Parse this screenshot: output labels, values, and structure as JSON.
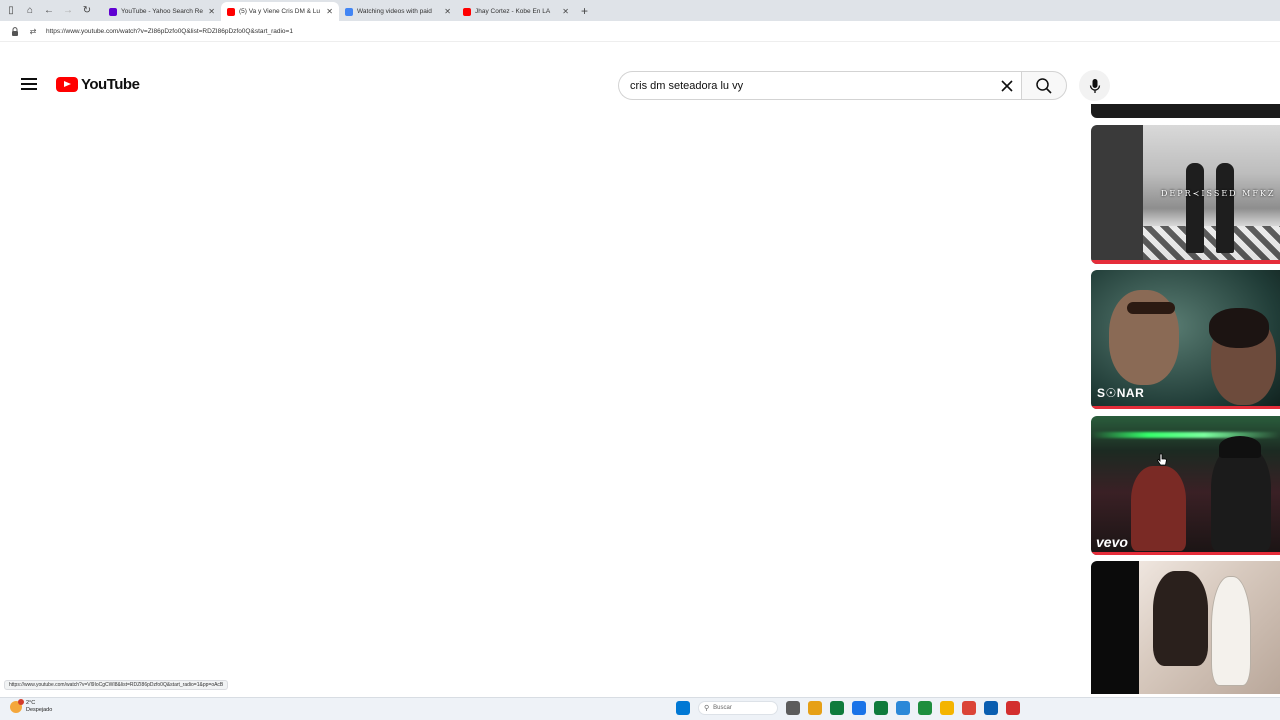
{
  "browser": {
    "tabs": [
      {
        "title": "YouTube - Yahoo Search Re",
        "favicon_color": "#6001d2",
        "active": false
      },
      {
        "title": "(5) Va y Viene Cris DM & Lu",
        "favicon_color": "#ff0000",
        "active": true
      },
      {
        "title": "Watching videos with paid",
        "favicon_color": "#4285f4",
        "active": false
      },
      {
        "title": "Jhay Cortez - Kobe En LA",
        "favicon_color": "#ff0000",
        "active": false
      }
    ],
    "new_tab_glyph": "+",
    "close_glyph": "✕",
    "url": "https://www.youtube.com/watch?v=ZI86pDzfo0Q&list=RDZI86pDzfo0Q&start_radio=1",
    "status_link": "https://www.youtube.com/watch?v=Vl9IoCgCWI8&list=RDZI86pDzfo0Q&start_radio=1&pp=oAcB"
  },
  "youtube": {
    "logo_text": "YouTube",
    "search": {
      "value": "cris dm seteadora lu vy",
      "placeholder": "Search"
    },
    "thumbnails": [
      {
        "overlay_text": ""
      },
      {
        "overlay_text": "DEPR≺ISSED MFKZ"
      },
      {
        "overlay_text": "S☉NAR"
      },
      {
        "overlay_text": "vevo"
      },
      {
        "overlay_text": ""
      }
    ]
  },
  "taskbar": {
    "weather_temp": "2°C",
    "weather_desc": "Despejado",
    "search_placeholder": "Buscar",
    "icon_colors": [
      "#0078d4",
      "#5c5c5c",
      "#e6a017",
      "#0f7b3c",
      "#1a73e8",
      "#0f7b3c",
      "#2b88d8",
      "#1e8e3e",
      "#f4b400",
      "#db4437",
      "#0a5eb0",
      "#d32f2f"
    ]
  },
  "accent_colors": {
    "youtube_red": "#ff0000",
    "progress_red": "#e52d3a"
  }
}
